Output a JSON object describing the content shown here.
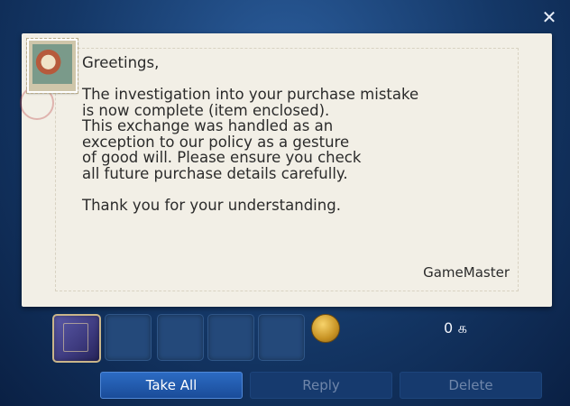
{
  "window": {
    "close_label": "✕"
  },
  "letter": {
    "stamp_icon": "postage-stamp-icon",
    "body": "Greetings,\n\nThe investigation into your purchase mistake\nis now complete (item enclosed).\nThis exchange was handled as an\nexception to our policy as a gesture\nof good will. Please ensure you check\nall future purchase details carefully.\n\nThank you for your understanding.",
    "signature": "GameMaster"
  },
  "attachments": {
    "items": [
      {
        "icon": "book-icon"
      },
      {
        "icon": ""
      },
      {
        "icon": ""
      },
      {
        "icon": ""
      },
      {
        "icon": ""
      }
    ],
    "currency_icon": "gil-coin-icon",
    "gil_amount": "0 ௧"
  },
  "buttons": {
    "take_all": "Take All",
    "reply": "Reply",
    "delete": "Delete"
  },
  "colors": {
    "accent": "#2c6bc3",
    "paper": "#f2efe6",
    "disabled_text": "#6f86aa"
  }
}
